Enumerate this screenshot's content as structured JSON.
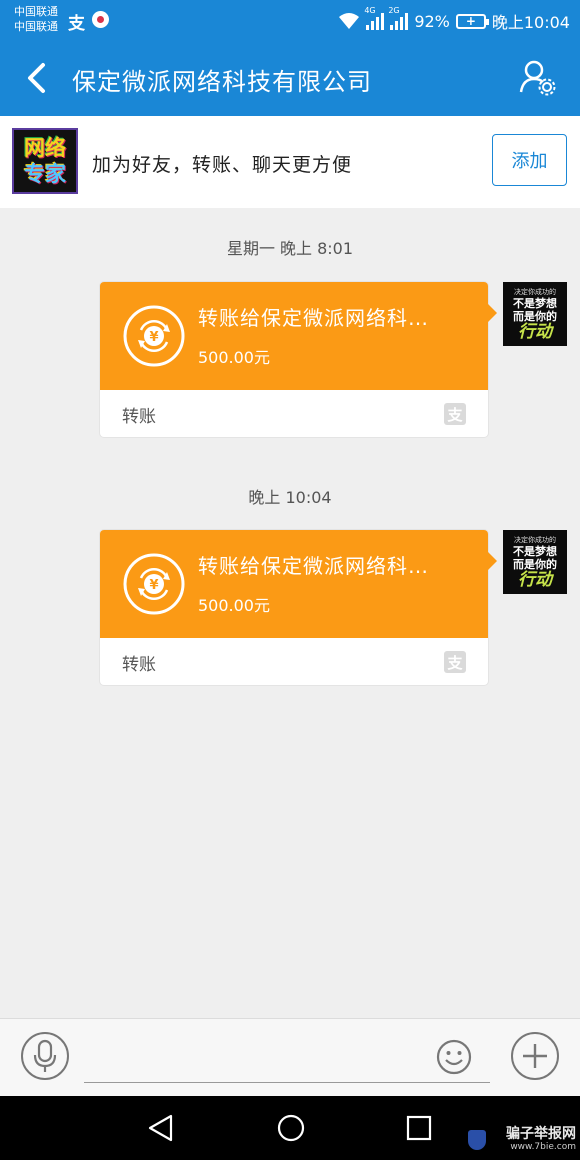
{
  "status_bar": {
    "carrier1": "中国联通",
    "carrier2": "中国联通",
    "app_icon": "支",
    "net1": "4G",
    "net2": "2G",
    "battery": "92%",
    "time": "晚上10:04"
  },
  "header": {
    "title": "保定微派网络科技有限公司",
    "back_icon": "chevron-left-icon",
    "profile_icon": "user-settings-icon"
  },
  "banner": {
    "logo_line1": "网络",
    "logo_line2": "专家",
    "text": "加为好友，转账、聊天更方便",
    "add_label": "添加"
  },
  "messages": [
    {
      "timestamp": "星期一 晚上 8:01",
      "title": "转账给保定微派网络科…",
      "amount": "500.00元",
      "type_label": "转账",
      "provider_icon": "支"
    },
    {
      "timestamp": "晚上 10:04",
      "title": "转账给保定微派网络科…",
      "amount": "500.00元",
      "type_label": "转账",
      "provider_icon": "支"
    }
  ],
  "avatar": {
    "line1": "决定你成功的",
    "line2": "不是梦想",
    "line3": "而是你的",
    "line4": "行动"
  },
  "input": {
    "placeholder": ""
  },
  "watermark": {
    "line1": "骗子举报网",
    "line2": "www.7bie.com"
  },
  "colors": {
    "primary": "#1a87d6",
    "transfer": "#fb9a15",
    "background": "#efefef"
  }
}
